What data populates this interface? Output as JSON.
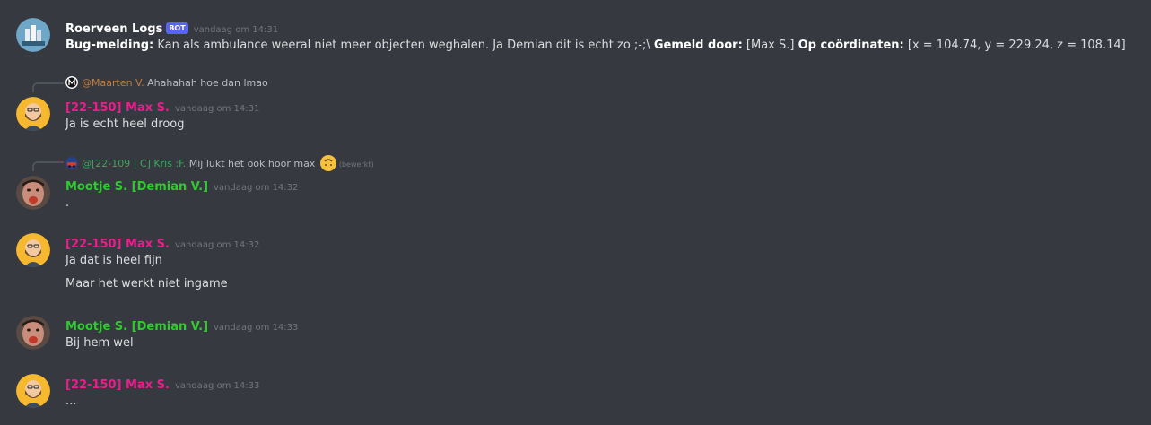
{
  "colors": {
    "background": "#36393f",
    "bot_tag": "#5865f2",
    "max_role": "#e91e8c",
    "mootje_role": "#2ecc2e",
    "maarten_mention": "#c27c3e",
    "kris_mention": "#3ba55d"
  },
  "messages": [
    {
      "author": "Roerveen Logs",
      "bot_tag": "BOT",
      "time": "vandaag om 14:31",
      "avatar_icon": "city-skyline-icon",
      "segments": {
        "b1": "Bug-melding:",
        "t1": " Kan als ambulance weeral niet meer objecten weghalen. Ja Demian dit is echt zo ;-;\\ ",
        "b2": "Gemeld door:",
        "t2": " [Max S.] ",
        "b3": "Op coördinaten:",
        "t3": " [x = 104.74, y = 229.24, z = 108.14]"
      }
    },
    {
      "reply": {
        "mention": "@Maarten V.",
        "text": "Ahahahah hoe dan lmao",
        "avatar_icon": "m-logo-icon"
      },
      "author": "[22-150] Max S.",
      "time": "vandaag om 14:31",
      "avatar_icon": "bearded-man-avatar-icon",
      "lines": [
        "Ja is echt heel droog"
      ]
    },
    {
      "reply": {
        "mention": "@[22-109 | C] Kris :F.",
        "text": "Mij lukt het ook hoor max",
        "edited": "(bewerkt)",
        "avatar_icon": "car-avatar-icon",
        "emoji": "upside-down-face-emoji"
      },
      "author": "Mootje S. [Demian V.]",
      "time": "vandaag om 14:32",
      "avatar_icon": "face-photo-avatar-icon",
      "lines": [
        "."
      ]
    },
    {
      "author": "[22-150] Max S.",
      "time": "vandaag om 14:32",
      "avatar_icon": "bearded-man-avatar-icon",
      "lines": [
        "Ja dat is heel fijn",
        "Maar het werkt niet ingame"
      ]
    },
    {
      "author": "Mootje S. [Demian V.]",
      "time": "vandaag om 14:33",
      "avatar_icon": "face-photo-avatar-icon",
      "lines": [
        "Bij hem wel"
      ]
    },
    {
      "author": "[22-150] Max S.",
      "time": "vandaag om 14:33",
      "avatar_icon": "bearded-man-avatar-icon",
      "lines": [
        "..."
      ]
    }
  ]
}
